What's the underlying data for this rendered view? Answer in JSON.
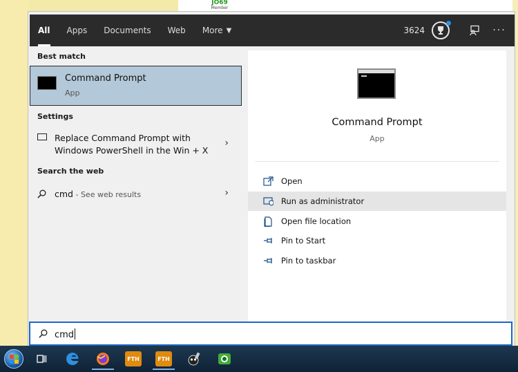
{
  "background": {
    "username": "JO69",
    "role": "Member"
  },
  "topbar": {
    "tabs": [
      {
        "label": "All"
      },
      {
        "label": "Apps"
      },
      {
        "label": "Documents"
      },
      {
        "label": "Web"
      },
      {
        "label": "More"
      }
    ],
    "points": "3624",
    "more_menu_glyph": "···"
  },
  "left": {
    "best_match_heading": "Best match",
    "best_match": {
      "title": "Command Prompt",
      "subtitle": "App",
      "icon": "command-prompt-icon"
    },
    "settings_heading": "Settings",
    "setting_line1": "Replace Command Prompt with",
    "setting_line2": "Windows PowerShell in the Win + X",
    "web_heading": "Search the web",
    "web_query": "cmd",
    "web_suffix": " - See web results"
  },
  "right": {
    "title": "Command Prompt",
    "subtitle": "App",
    "actions": [
      {
        "label": "Open",
        "icon": "open-icon"
      },
      {
        "label": "Run as administrator",
        "icon": "shield-icon"
      },
      {
        "label": "Open file location",
        "icon": "file-icon"
      },
      {
        "label": "Pin to Start",
        "icon": "pin-icon"
      },
      {
        "label": "Pin to taskbar",
        "icon": "pin-icon"
      }
    ]
  },
  "search": {
    "value": "cmd"
  },
  "taskbar": {
    "fth1": "FTH",
    "fth2": "FTH"
  },
  "colors": {
    "accent": "#1d66c4",
    "topbar": "#2b2b2b",
    "selected": "#b3c8d8"
  }
}
